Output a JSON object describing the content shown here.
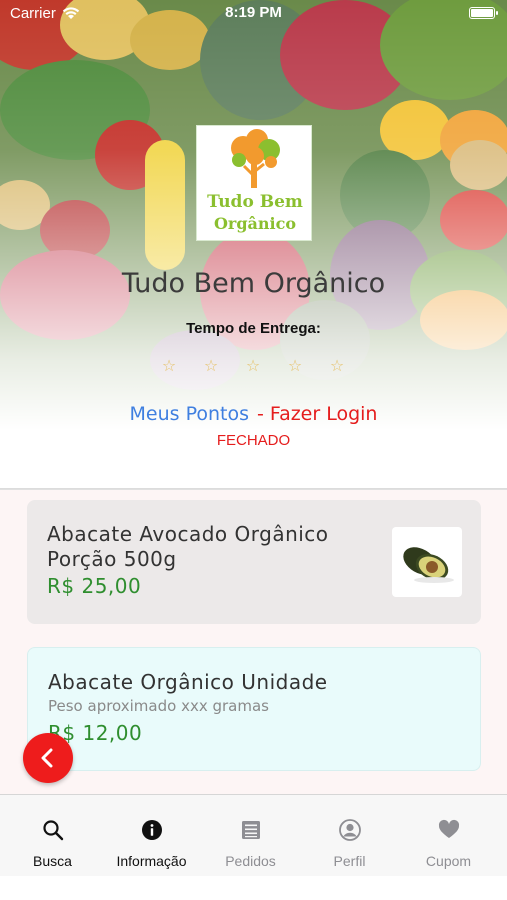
{
  "status_bar": {
    "carrier": "Carrier",
    "time": "8:19 PM"
  },
  "store": {
    "logo_line1": "Tudo Bem",
    "logo_line2": "Orgânico",
    "name": "Tudo Bem Orgânico",
    "delivery_label": "Tempo de Entrega:",
    "rating_stars": 5,
    "points_link": "Meus Pontos",
    "login_link": "- Fazer Login",
    "status": "FECHADO"
  },
  "products": [
    {
      "name_line1": "Abacate Avocado Orgânico",
      "name_line2": "Porção 500g",
      "price": "R$ 25,00",
      "image_icon": "avocado-image"
    },
    {
      "name": "Abacate Orgânico Unidade",
      "description": "Peso aproximado xxx gramas",
      "price": "R$ 12,00"
    }
  ],
  "tabs": [
    {
      "label": "Busca",
      "icon": "search-icon",
      "active": true
    },
    {
      "label": "Informação",
      "icon": "info-icon",
      "active": true
    },
    {
      "label": "Pedidos",
      "icon": "list-icon",
      "active": false
    },
    {
      "label": "Perfil",
      "icon": "profile-icon",
      "active": false
    },
    {
      "label": "Cupom",
      "icon": "heart-icon",
      "active": false
    }
  ],
  "colors": {
    "accent_red": "#e51d1d",
    "link_blue": "#3f7fe0",
    "price_green": "#2f8e2f",
    "logo_green": "#8bbf2f",
    "logo_orange": "#f29a2e"
  }
}
